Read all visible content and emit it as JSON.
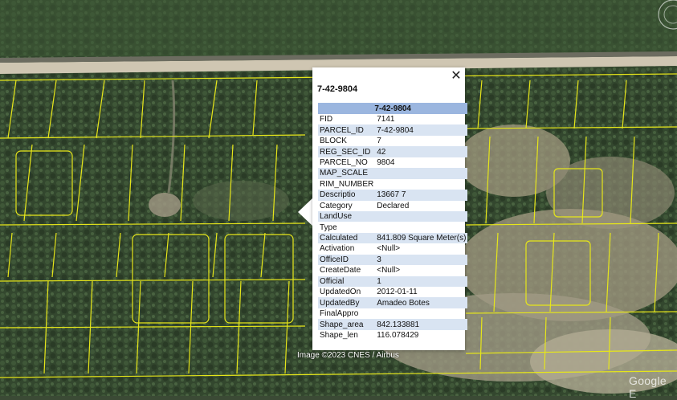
{
  "popup": {
    "title": "7-42-9804",
    "close_label": "✕",
    "table_header": "7-42-9804",
    "rows": [
      {
        "key": "FID",
        "value": "7141"
      },
      {
        "key": "PARCEL_ID",
        "value": "7-42-9804"
      },
      {
        "key": "BLOCK",
        "value": "7"
      },
      {
        "key": "REG_SEC_ID",
        "value": "42"
      },
      {
        "key": "PARCEL_NO",
        "value": "9804"
      },
      {
        "key": "MAP_SCALE",
        "value": ""
      },
      {
        "key": "RIM_NUMBER",
        "value": ""
      },
      {
        "key": "Descriptio",
        "value": "13667 7"
      },
      {
        "key": "Category",
        "value": "Declared"
      },
      {
        "key": "LandUse",
        "value": ""
      },
      {
        "key": "Type",
        "value": ""
      },
      {
        "key": "Calculated",
        "value": "841.809 Square Meter(s)"
      },
      {
        "key": "Activation",
        "value": "<Null>"
      },
      {
        "key": "OfficeID",
        "value": "3"
      },
      {
        "key": "CreateDate",
        "value": "<Null>"
      },
      {
        "key": "Official",
        "value": "1"
      },
      {
        "key": "UpdatedOn",
        "value": "2012-01-11"
      },
      {
        "key": "UpdatedBy",
        "value": "Amadeo Botes"
      },
      {
        "key": "FinalAppro",
        "value": ""
      },
      {
        "key": "Shape_area",
        "value": "842.133881"
      },
      {
        "key": "Shape_len",
        "value": "116.078429"
      }
    ]
  },
  "map": {
    "copyright": "Image ©2023 CNES / Airbus",
    "logo": "Google E",
    "parcel_line_color": "#e6e61a"
  }
}
